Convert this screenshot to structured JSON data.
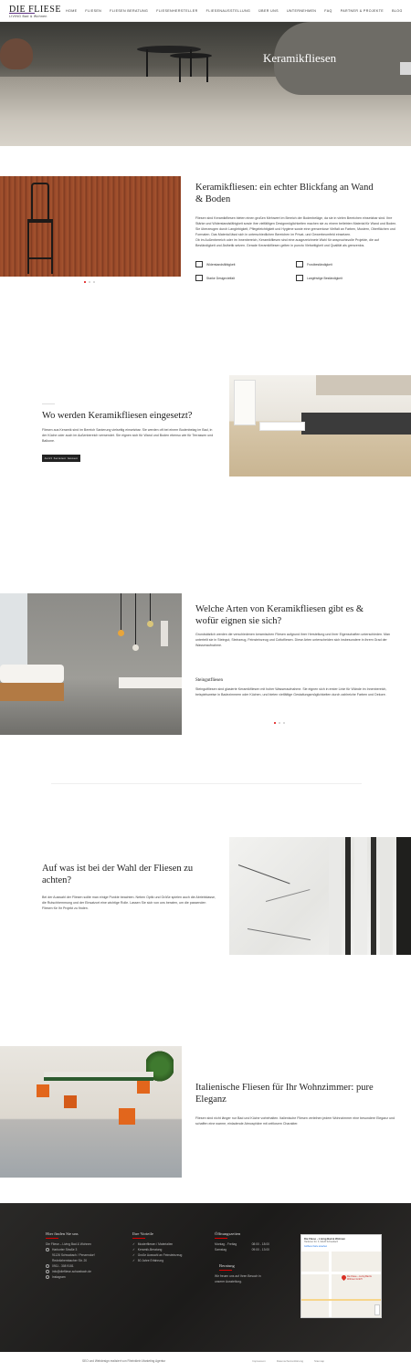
{
  "header": {
    "logo": "DIE FLIESE",
    "logo_sub": "LIVING Bad & Wohnen",
    "nav": [
      "Home",
      "Fliesen",
      "Fliesen Beratung",
      "Fliesenhersteller",
      "Fliesenausstellung",
      "Über uns",
      "Unternehmen",
      "FAQ",
      "Partner & Projekte",
      "Blog"
    ]
  },
  "hero": {
    "title": "Keramikfliesen"
  },
  "sec1": {
    "heading": "Keramikfliesen: ein echter Blickfang an Wand & Boden",
    "p1": "Fliesen sind Keramikfliesen bieten einen großen Mehrwert im Bereich der Bodenbeläge, da sie in vielen Bereichen einsetzbar sind. Ihre Stärke und Widerstandsfähigkeit sowie ihre vielfältigen Designmöglichkeiten machen sie zu einem beliebten Material für Wand und Boden.",
    "p2": "Sie überzeugen durch Langlebigkeit, Pflegeleichtigkeit und Hygiene sowie eine grenzenlose Vielfalt an Farben, Mustern, Oberflächen und Formaten. Das Material lässt sich in unterschiedlichen Bereichen im Privat- und Gewerbeumfeld einsetzen.",
    "p3": "Ob im Außenbereich oder im Innenbereich, Keramikfliesen sind eine ausgezeichnete Wahl für anspruchsvolle Projekte, die auf Beständigkeit und Ästhetik setzen. Gerade Keramikfliesen gelten in puncto Vielseitigkeit und Qualität als grenzenlos.",
    "features": [
      {
        "icon": "shield-icon",
        "label": "Widerstandsfähigkeit"
      },
      {
        "icon": "frost-icon",
        "label": "Frostbeständigkeit"
      },
      {
        "icon": "design-icon",
        "label": "Starke Designvielfalt"
      },
      {
        "icon": "durability-icon",
        "label": "Langfristige Beständigkeit"
      }
    ]
  },
  "sec2": {
    "heading": "Wo werden Keramikfliesen eingesetzt?",
    "p1": "Fliesen aus Keramik sind im Bereich Sanierung vielseitig einsetzbar. Sie werden oft bei einem Bodenbelag im Bad, in der Küche oder auch im Außenbereich verwendet. Sie eignen sich für Wand und Boden ebenso wie für Terrassen und Balkone.",
    "button": "Jetzt beraten lassen"
  },
  "sec3": {
    "heading": "Welche Arten von Keramikfliesen gibt es & wofür eignen sie sich?",
    "p1": "Grundsätzlich werden die verschiedenen keramischen Fliesen aufgrund ihrer Herstellung und ihrer Eigenschaften unterschieden. Man unterteilt sie in Steingut, Steinzeug, Feinsteinzeug und Cottofliesen. Diese Arten unterscheiden sich insbesondere in ihrem Grad der Wasseraufnahme.",
    "subheading": "Steingutfliesen",
    "p2": "Steingutfliesen sind glasierte Keramikfliesen mit hoher Wasseraufnahme. Sie eignen sich in erster Linie für Wände im Innenbereich, beispielsweise in Badezimmern oder Küchen, und bieten vielfältige Gestaltungsmöglichkeiten durch zahlreiche Farben und Dekore."
  },
  "sec4": {
    "heading": "Auf was ist bei der Wahl der Fliesen zu achten?",
    "p1": "Bei der Auswahl der Fliesen sollte man einige Punkte beachten. Neben Optik und Größe spielen auch die Abriebklasse, die Rutschhemmung und der Einsatzort eine wichtige Rolle. Lassen Sie sich von uns beraten, um die passenden Fliesen für Ihr Projekt zu finden."
  },
  "sec5": {
    "heading": "Italienische Fliesen für Ihr Wohnzimmer: pure Eleganz",
    "p1": "Fliesen sind nicht länger nur Bad und Küche vorbehalten. Italienische Fliesen verleihen jedem Wohnzimmer eine besondere Eleganz und schaffen eine warme, einladende Atmosphäre mit zeitlosem Charakter."
  },
  "footer": {
    "col1": {
      "title": "Hier finden Sie uns",
      "lines": [
        "Die Fliese – Living Bad & Wohnen",
        "Harkorter Straße 3",
        "91126 Schwabach / Penzendorf",
        "Rednitzhembacher Str. 20",
        "0911 - 308 9151",
        "info@diefliese-schwabach.de",
        "Instagram"
      ]
    },
    "col2": {
      "title": "Ihre Vorteile",
      "lines": [
        "Musterfliesen / Materialien",
        "Keramik-Beratung",
        "Große Auswahl an Feinsteinzeug",
        "50 Jahre Erfahrung"
      ]
    },
    "col3": {
      "title": "Öffnungszeiten",
      "hours": [
        {
          "day": "Montag - Freitag",
          "time": "08:00 - 18:00"
        },
        {
          "day": "Samstag",
          "time": "09:00 - 13:00"
        }
      ],
      "title2": "Beratung",
      "text": "Wir freuen uns auf Ihren Besuch in unserer Ausstellung."
    },
    "map": {
      "place": "Die Fliese – Living Bad & Wohnen",
      "address": "Harkorter Str. 3, 91126 Schwabach",
      "link": "Größere Karte ansehen",
      "marker": "Die Fliese – Living Bad & Wohnen GmbH"
    }
  },
  "bottom": {
    "credit": "SEO und Webdesign realisiert von Rheinklein Marketing Agentur",
    "links": [
      "Impressum",
      "Datenschutzerklärung",
      "Sitemap"
    ]
  },
  "colors": {
    "accent": "#d00000",
    "brand": "#5a2d82",
    "footer_bg": "#1f1e1d"
  }
}
